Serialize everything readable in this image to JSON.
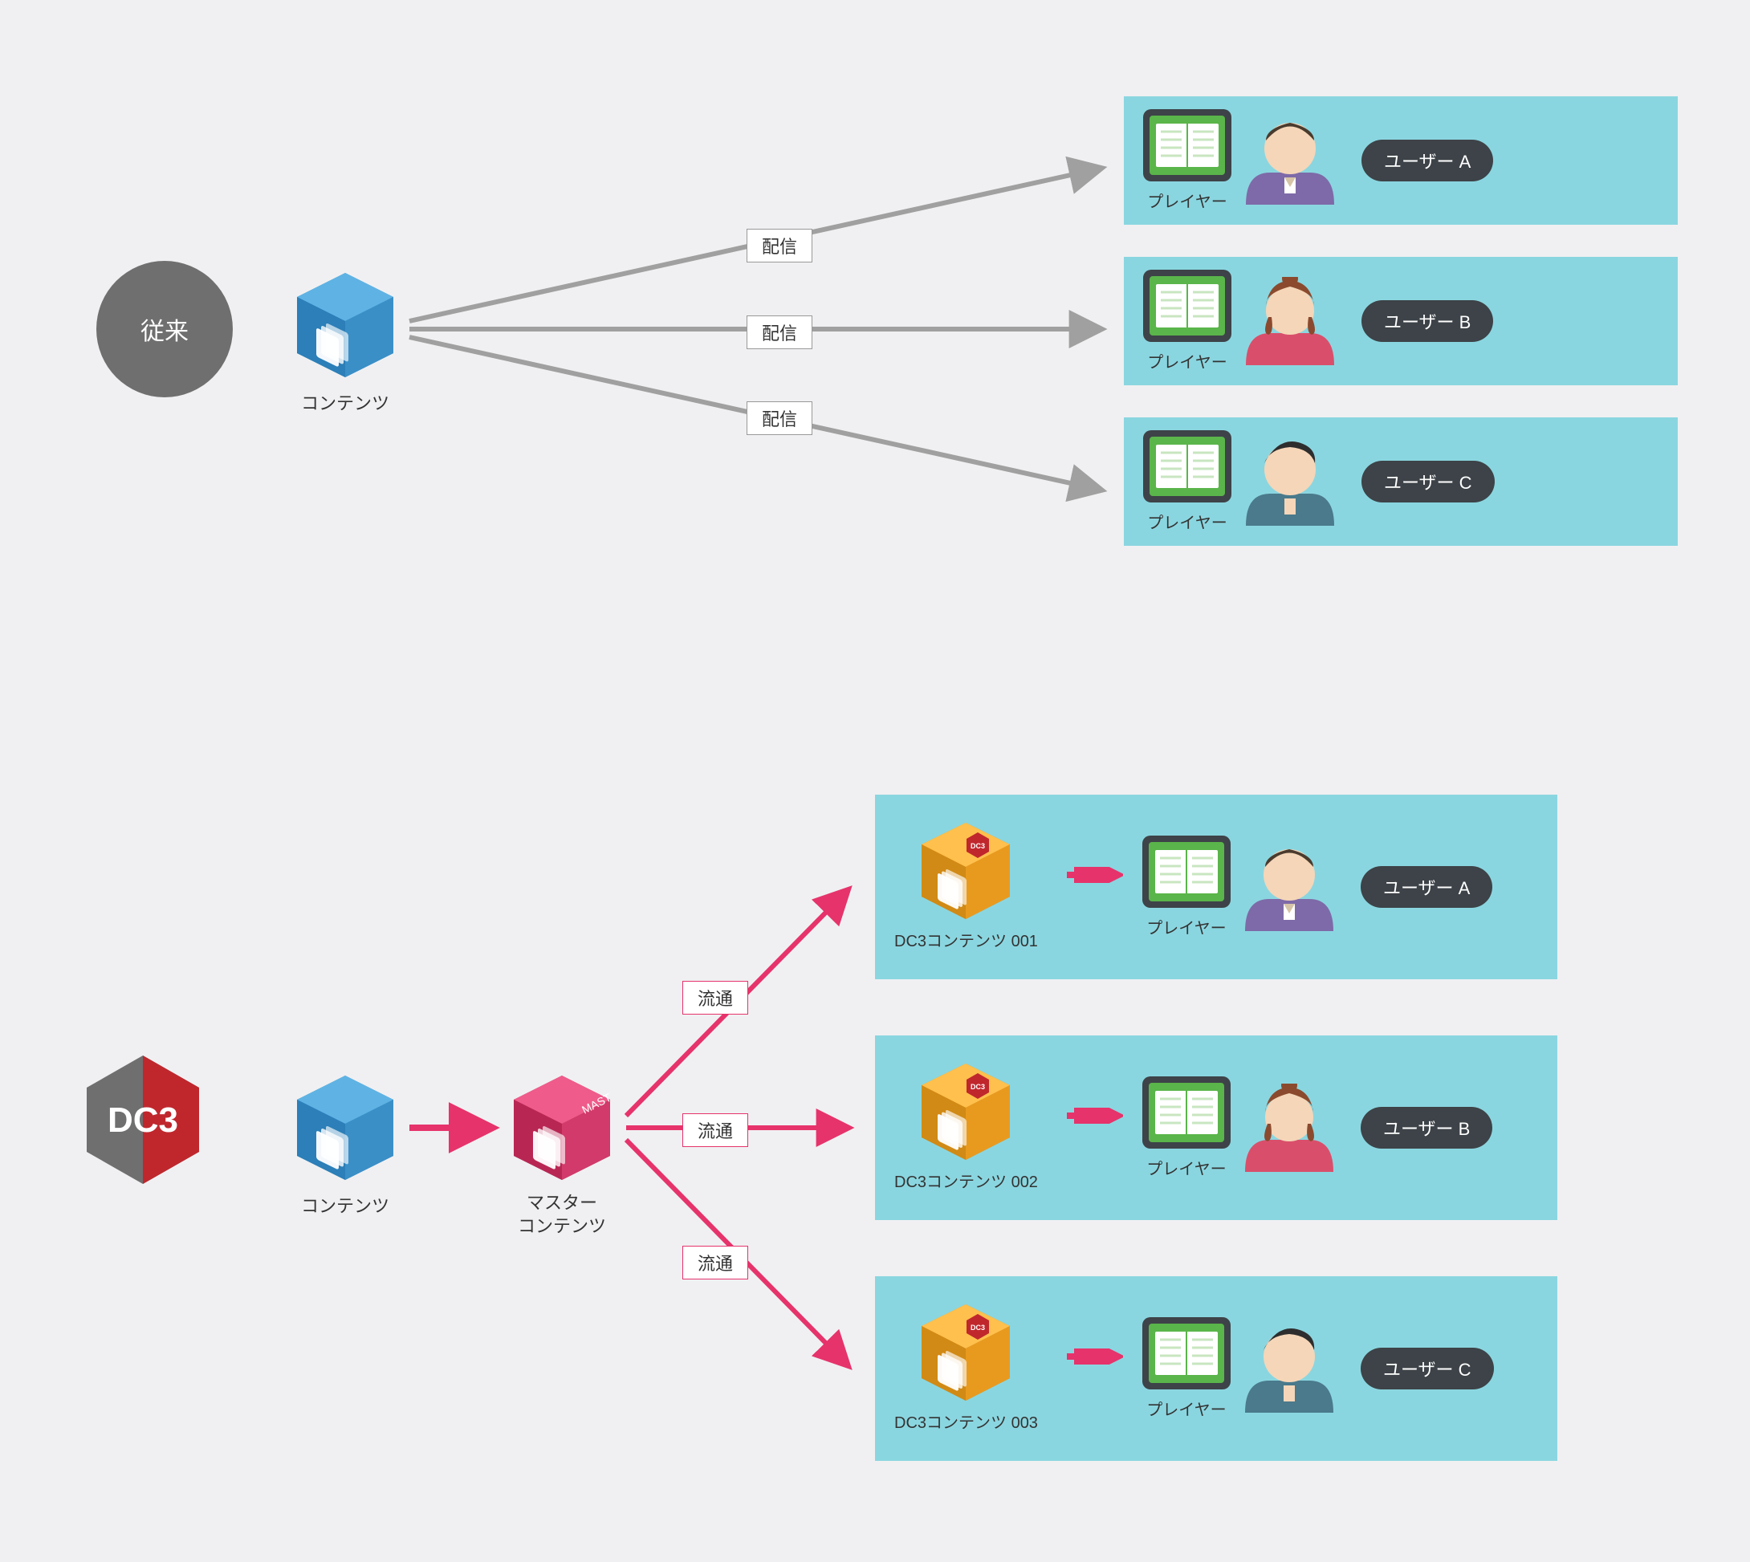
{
  "traditional": {
    "badge": "従来",
    "content_label": "コンテンツ",
    "arrow_label": "配信",
    "player_label": "プレイヤー",
    "users": [
      {
        "name": "ユーザー A"
      },
      {
        "name": "ユーザー B"
      },
      {
        "name": "ユーザー C"
      }
    ]
  },
  "dc3": {
    "logo_text": "DC3",
    "content_label": "コンテンツ",
    "master_label": "マスター\nコンテンツ",
    "master_tag": "MASTER",
    "arrow_label": "流通",
    "player_label": "プレイヤー",
    "items": [
      {
        "label": "DC3コンテンツ 001",
        "user": "ユーザー A"
      },
      {
        "label": "DC3コンテンツ 002",
        "user": "ユーザー B"
      },
      {
        "label": "DC3コンテンツ 003",
        "user": "ユーザー C"
      }
    ]
  },
  "colors": {
    "gray": "#a0a0a0",
    "pink": "#e6336b",
    "teal": "#8ad6e0",
    "blue_cube": "#3aa0dd",
    "orange_cube": "#f5a623",
    "master_cube": "#e6336b",
    "green_player": "#5ab54a"
  }
}
